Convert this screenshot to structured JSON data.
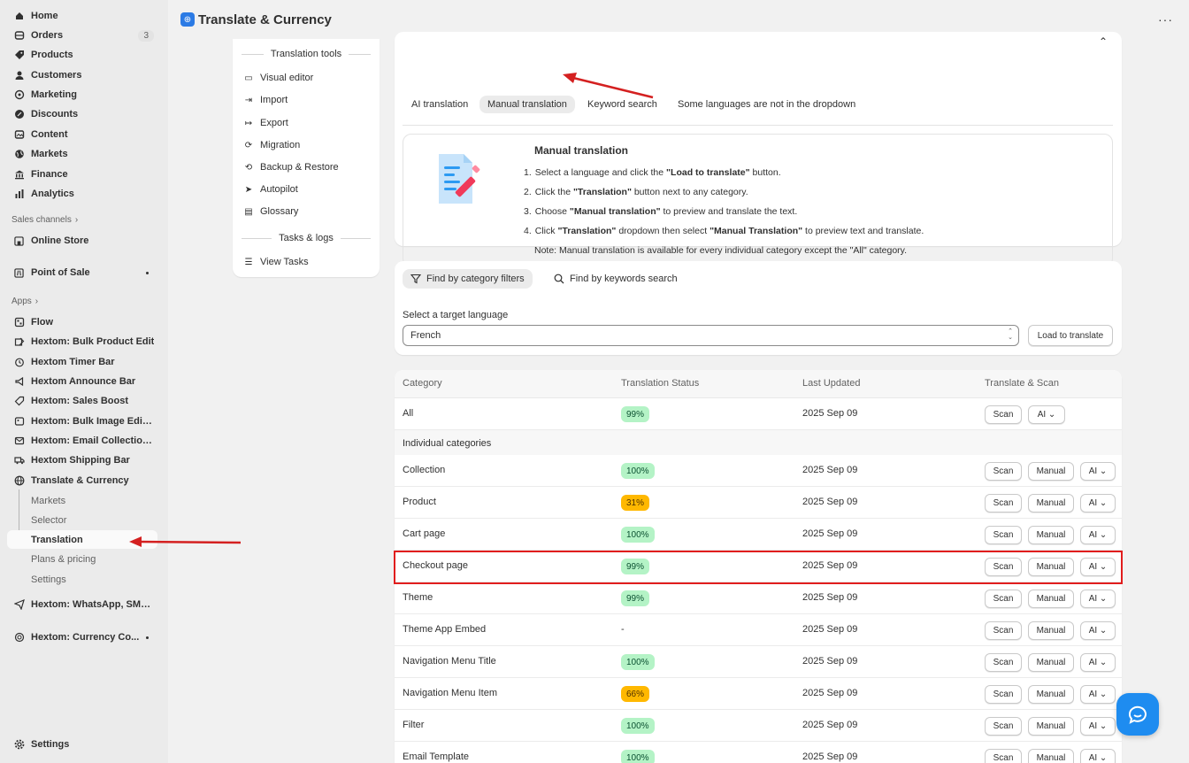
{
  "sidebar": {
    "nav": [
      {
        "label": "Home",
        "icon": "home-icon"
      },
      {
        "label": "Orders",
        "icon": "orders-icon",
        "badge": "3"
      },
      {
        "label": "Products",
        "icon": "tag-icon"
      },
      {
        "label": "Customers",
        "icon": "person-icon"
      },
      {
        "label": "Marketing",
        "icon": "target-icon"
      },
      {
        "label": "Discounts",
        "icon": "discount-icon"
      },
      {
        "label": "Content",
        "icon": "content-icon"
      },
      {
        "label": "Markets",
        "icon": "globe-icon"
      },
      {
        "label": "Finance",
        "icon": "bank-icon"
      },
      {
        "label": "Analytics",
        "icon": "chart-icon"
      }
    ],
    "sales_channels_label": "Sales channels",
    "online_store": "Online Store",
    "point_of_sale": "Point of Sale",
    "apps_label": "Apps",
    "apps": [
      {
        "label": "Flow"
      },
      {
        "label": "Hextom: Bulk Product Edit"
      },
      {
        "label": "Hextom Timer Bar"
      },
      {
        "label": "Hextom Announce Bar"
      },
      {
        "label": "Hextom: Sales Boost"
      },
      {
        "label": "Hextom: Bulk Image Edit &..."
      },
      {
        "label": "Hextom: Email Collection ..."
      },
      {
        "label": "Hextom Shipping Bar"
      },
      {
        "label": "Translate & Currency"
      }
    ],
    "sub_items": [
      {
        "label": "Markets"
      },
      {
        "label": "Selector"
      },
      {
        "label": "Translation"
      },
      {
        "label": "Plans & pricing"
      },
      {
        "label": "Settings"
      }
    ],
    "whatsapp": "Hextom: WhatsApp, SMS ...",
    "currency_app": "Hextom: Currency Co...",
    "settings": "Settings"
  },
  "header": {
    "title": "Translate & Currency"
  },
  "tools": {
    "section1": "Translation tools",
    "items1": [
      "Visual editor",
      "Import",
      "Export",
      "Migration",
      "Backup & Restore",
      "Autopilot",
      "Glossary"
    ],
    "section2": "Tasks & logs",
    "items2": [
      "View Tasks"
    ]
  },
  "faq": {
    "tabs": [
      "AI translation",
      "Manual translation",
      "Keyword search",
      "Some languages are not in the dropdown"
    ],
    "box_title": "Manual translation",
    "steps": [
      {
        "n": "1.",
        "a": "Select a language and click the ",
        "b": "\"Load to translate\"",
        "c": " button.",
        "d": "",
        "e": ""
      },
      {
        "n": "2.",
        "a": "Click the ",
        "b": "\"Translation\"",
        "c": " button next to any category.",
        "d": "",
        "e": ""
      },
      {
        "n": "3.",
        "a": "Choose ",
        "b": "\"Manual translation\"",
        "c": " to preview and translate the text.",
        "d": "",
        "e": ""
      },
      {
        "n": "4.",
        "a": "Click ",
        "b": "\"Translation\"",
        "c": " dropdown then select ",
        "d": "\"Manual Translation\"",
        "e": " to preview text and translate."
      }
    ],
    "note": "Note: Manual translation is available for every individual category except the \"All\" category."
  },
  "filters": {
    "tab_category": "Find by category filters",
    "tab_keywords": "Find by keywords search",
    "language_label": "Select a target language",
    "language_value": "French",
    "load_button": "Load to translate"
  },
  "table": {
    "headers": [
      "Category",
      "Translation Status",
      "Last Updated",
      "Translate & Scan"
    ],
    "all_row": {
      "category": "All",
      "status": "99%",
      "updated": "2025 Sep 09"
    },
    "group_label": "Individual categories",
    "rows": [
      {
        "category": "Collection",
        "status": "100%",
        "color": "green",
        "updated": "2025 Sep 09"
      },
      {
        "category": "Product",
        "status": "31%",
        "color": "orange",
        "updated": "2025 Sep 09"
      },
      {
        "category": "Cart page",
        "status": "100%",
        "color": "green",
        "updated": "2025 Sep 09"
      },
      {
        "category": "Checkout page",
        "status": "99%",
        "color": "green",
        "updated": "2025 Sep 09"
      },
      {
        "category": "Theme",
        "status": "99%",
        "color": "green",
        "updated": "2025 Sep 09"
      },
      {
        "category": "Theme App Embed",
        "status": "-",
        "color": "none",
        "updated": "2025 Sep 09"
      },
      {
        "category": "Navigation Menu Title",
        "status": "100%",
        "color": "green",
        "updated": "2025 Sep 09"
      },
      {
        "category": "Navigation Menu Item",
        "status": "66%",
        "color": "orange",
        "updated": "2025 Sep 09"
      },
      {
        "category": "Filter",
        "status": "100%",
        "color": "green",
        "updated": "2025 Sep 09"
      },
      {
        "category": "Email Template",
        "status": "100%",
        "color": "green",
        "updated": "2025 Sep 09"
      }
    ],
    "btn_scan": "Scan",
    "btn_manual": "Manual",
    "btn_ai": "AI"
  },
  "colors": {
    "accent": "#1e8cf0",
    "highlight": "#e11d1d",
    "pill_green": "#b4f3c6",
    "pill_orange": "#ffb800"
  }
}
